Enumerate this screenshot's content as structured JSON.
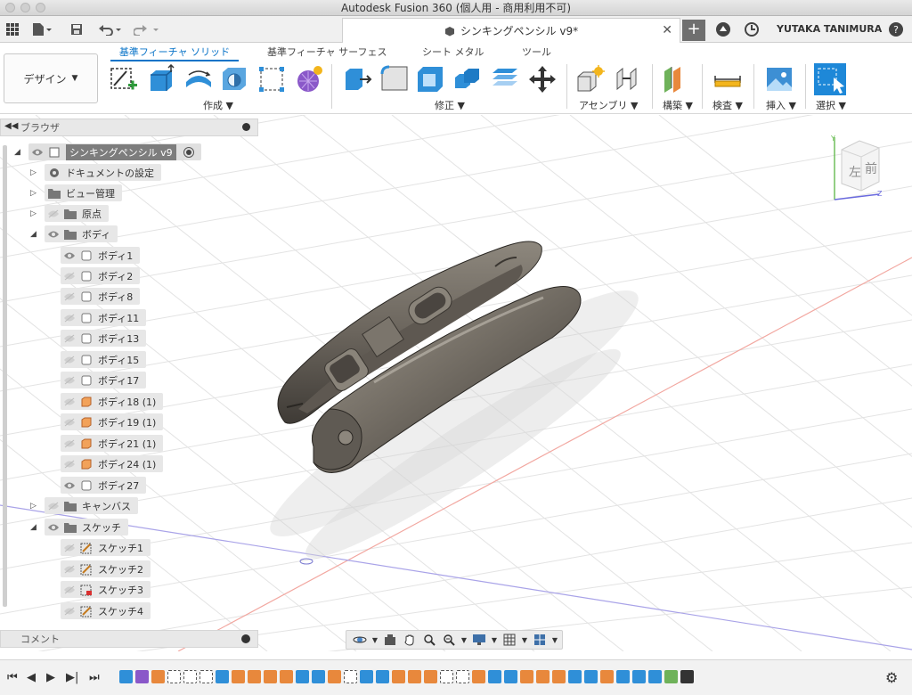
{
  "window": {
    "title": "Autodesk Fusion 360 (個人用 - 商用利用不可)"
  },
  "tabbar": {
    "doc_title": "シンキングペンシル v9*",
    "username": "YUTAKA TANIMURA",
    "new_tab_label": "+"
  },
  "workspace": {
    "label": "デザイン"
  },
  "ribbon": {
    "tabs": [
      {
        "label": "基準フィーチャ ソリッド",
        "active": true
      },
      {
        "label": "基準フィーチャ サーフェス"
      },
      {
        "label": "シート メタル"
      },
      {
        "label": "ツール"
      }
    ],
    "groups": {
      "create": "作成",
      "modify": "修正",
      "assembly": "アセンブリ",
      "construct": "構築",
      "inspect": "検査",
      "insert": "挿入",
      "select": "選択"
    }
  },
  "browser": {
    "title": "ブラウザ",
    "root": "シンキングペンシル v9",
    "items": [
      {
        "label": "ドキュメントの設定"
      },
      {
        "label": "ビュー管理"
      },
      {
        "label": "原点"
      },
      {
        "label": "ボディ"
      },
      {
        "label": "ボディ1"
      },
      {
        "label": "ボディ2"
      },
      {
        "label": "ボディ8"
      },
      {
        "label": "ボディ11"
      },
      {
        "label": "ボディ13"
      },
      {
        "label": "ボディ15"
      },
      {
        "label": "ボディ17"
      },
      {
        "label": "ボディ18 (1)"
      },
      {
        "label": "ボディ19 (1)"
      },
      {
        "label": "ボディ21 (1)"
      },
      {
        "label": "ボディ24 (1)"
      },
      {
        "label": "ボディ27"
      },
      {
        "label": "キャンバス"
      },
      {
        "label": "スケッチ"
      },
      {
        "label": "スケッチ1"
      },
      {
        "label": "スケッチ2"
      },
      {
        "label": "スケッチ3"
      },
      {
        "label": "スケッチ4"
      }
    ]
  },
  "viewcube": {
    "left_face": "左",
    "front_face": "前",
    "axis_y": "Y",
    "axis_z": "Z"
  },
  "comments": {
    "title": "コメント"
  },
  "colors": {
    "accent": "#0a74c8",
    "panel": "#e7e7e7",
    "model": "#6b655d"
  }
}
